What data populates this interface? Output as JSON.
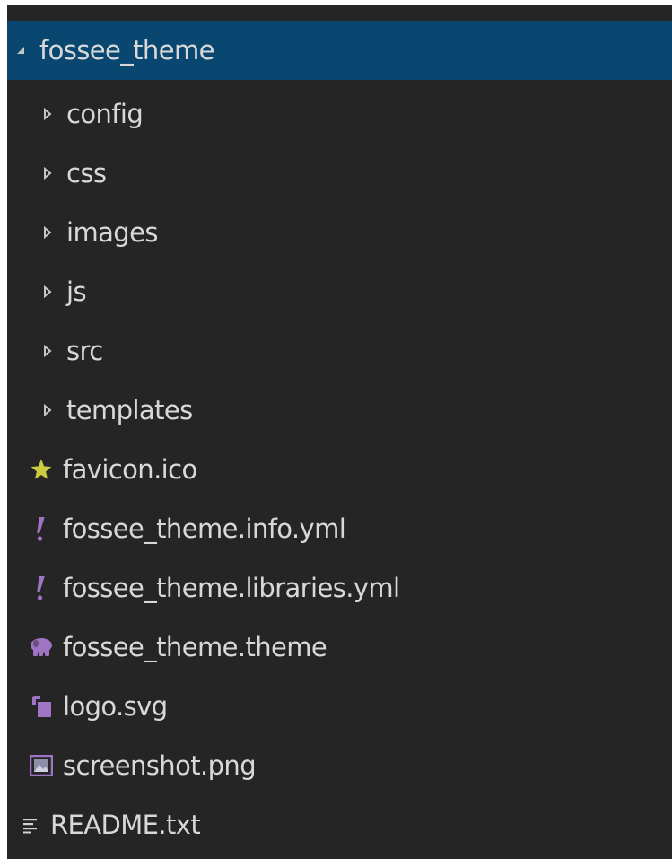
{
  "explorer": {
    "root": {
      "label": "fossee_theme",
      "expanded": true,
      "icon": "chevron-down-icon"
    },
    "folders": [
      {
        "label": "config",
        "icon": "chevron-right-icon"
      },
      {
        "label": "css",
        "icon": "chevron-right-icon"
      },
      {
        "label": "images",
        "icon": "chevron-right-icon"
      },
      {
        "label": "js",
        "icon": "chevron-right-icon"
      },
      {
        "label": "src",
        "icon": "chevron-right-icon"
      },
      {
        "label": "templates",
        "icon": "chevron-right-icon"
      }
    ],
    "files": [
      {
        "label": "favicon.ico",
        "icon": "star-icon",
        "color": "#cbcb41"
      },
      {
        "label": "fossee_theme.info.yml",
        "icon": "yaml-exclamation-icon",
        "color": "#a074c4"
      },
      {
        "label": "fossee_theme.libraries.yml",
        "icon": "yaml-exclamation-icon",
        "color": "#a074c4"
      },
      {
        "label": "fossee_theme.theme",
        "icon": "php-elephant-icon",
        "color": "#a074c4"
      },
      {
        "label": "logo.svg",
        "icon": "svg-image-icon",
        "color": "#a074c4"
      },
      {
        "label": "screenshot.png",
        "icon": "image-file-icon",
        "color": "#a074c4"
      },
      {
        "label": "README.txt",
        "icon": "text-lines-icon",
        "color": "#d4d4d4"
      }
    ]
  },
  "colors": {
    "background": "#252526",
    "selection": "#094771",
    "text": "#d8d8d8"
  }
}
